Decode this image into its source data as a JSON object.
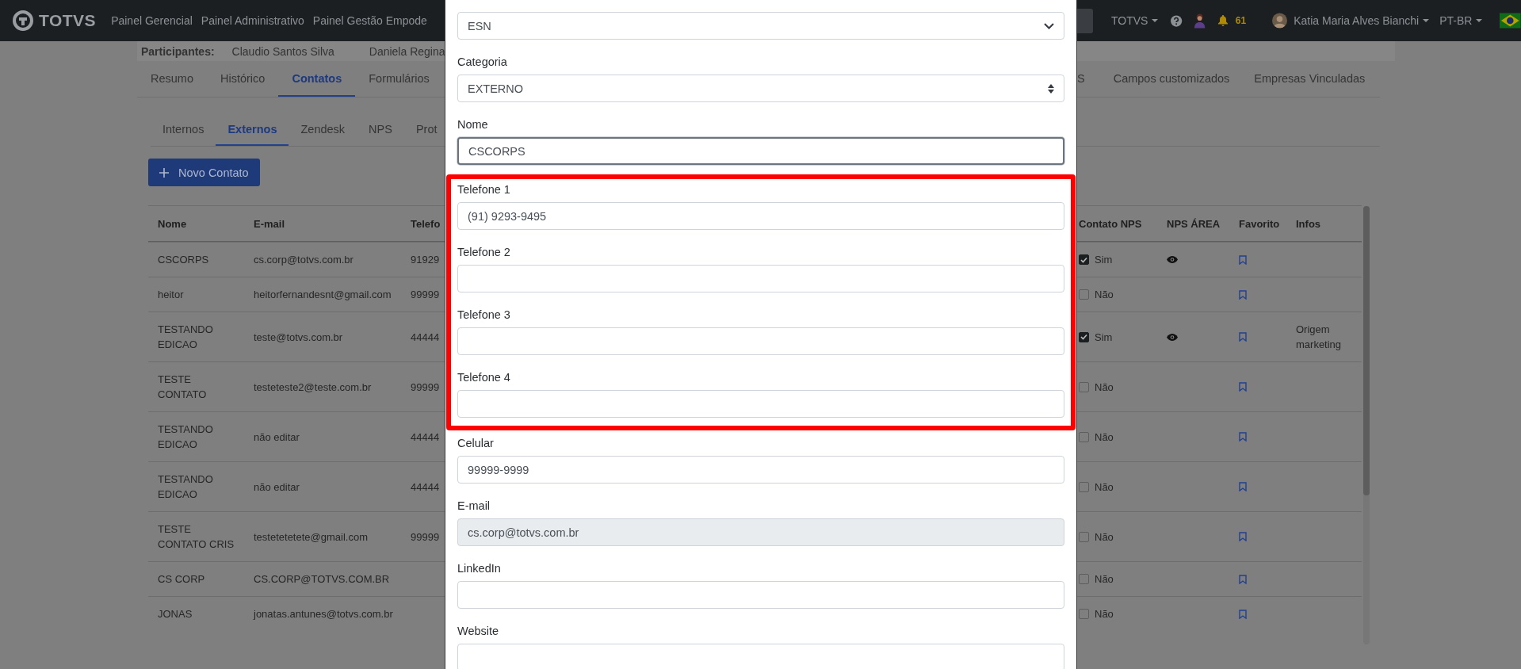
{
  "navbar": {
    "brand": "TOTVS",
    "links": [
      "Painel Gerencial",
      "Painel Administrativo",
      "Painel Gestão Empode"
    ],
    "org_menu": "TOTVS",
    "notifications": "61",
    "user": "Katia Maria Alves Bianchi",
    "language": "PT-BR"
  },
  "participants": {
    "label": "Participantes:",
    "names": [
      "Claudio Santos Silva",
      "Daniela Regina"
    ]
  },
  "tabs": {
    "before_modal": [
      {
        "label": "Resumo",
        "selected": false
      },
      {
        "label": "Histórico",
        "selected": false
      },
      {
        "label": "Contatos",
        "selected": true
      },
      {
        "label": "Formulários",
        "selected": false
      }
    ],
    "after_modal": [
      {
        "label": "S",
        "selected": false
      },
      {
        "label": "Campos customizados",
        "selected": false
      },
      {
        "label": "Empresas Vinculadas",
        "selected": false
      }
    ]
  },
  "subtabs": [
    {
      "label": "Internos",
      "selected": false
    },
    {
      "label": "Externos",
      "selected": true
    },
    {
      "label": "Zendesk",
      "selected": false
    },
    {
      "label": "NPS",
      "selected": false
    },
    {
      "label": "Prot",
      "selected": false
    }
  ],
  "new_contact_button": "Novo Contato",
  "table": {
    "columns_before_modal": [
      "Nome",
      "E-mail",
      "Telefo"
    ],
    "columns_after_modal": [
      "Contato NPS",
      "NPS ÁREA",
      "Favorito",
      "Infos"
    ],
    "rows": [
      {
        "name": "CSCORPS",
        "email": "cs.corp@totvs.com.br",
        "phone": "91929",
        "nps_contact": true,
        "nps_label": "Sim",
        "nps_area": true,
        "favorite": false
      },
      {
        "name": "heitor",
        "email": "heitorfernandesnt@gmail.com",
        "phone": "99999",
        "nps_contact": false,
        "nps_label": "Não",
        "nps_area": false,
        "favorite": false
      },
      {
        "name": "TESTANDO EDICAO",
        "email": "teste@totvs.com.br",
        "phone": "44444",
        "nps_contact": true,
        "nps_label": "Sim",
        "nps_area": true,
        "favorite": false,
        "infos": "Origem marketing"
      },
      {
        "name": "TESTE CONTATO",
        "email": "testeteste2@teste.com.br",
        "phone": "99999",
        "nps_contact": false,
        "nps_label": "Não",
        "nps_area": false,
        "favorite": false
      },
      {
        "name": "TESTANDO EDICAO",
        "email": "não editar",
        "phone": "44444",
        "nps_contact": false,
        "nps_label": "Não",
        "nps_area": false,
        "favorite": false
      },
      {
        "name": "TESTANDO EDICAO",
        "email": "não editar",
        "phone": "44444",
        "nps_contact": false,
        "nps_label": "Não",
        "nps_area": false,
        "favorite": false
      },
      {
        "name": "TESTE CONTATO CRIS",
        "email": "testetetetete@gmail.com",
        "phone": "99999",
        "nps_contact": false,
        "nps_label": "Não",
        "nps_area": false,
        "favorite": false
      },
      {
        "name": "CS CORP",
        "email": "CS.CORP@TOTVS.COM.BR",
        "nps_contact": false,
        "nps_label": "Não",
        "nps_area": false,
        "favorite": false
      },
      {
        "name": "JONAS",
        "email": "jonatas.antunes@totvs.com.br",
        "nps_contact": false,
        "nps_label": "Não",
        "nps_area": false,
        "favorite": false
      }
    ]
  },
  "modal": {
    "fields_before": [
      {
        "kind": "select",
        "value": "ESN",
        "focused": false,
        "disabled": false
      },
      {
        "kind": "spinner-select",
        "label": "Categoria",
        "value": "EXTERNO",
        "focused": false,
        "disabled": false
      },
      {
        "kind": "input",
        "label": "Nome",
        "value": "CSCORPS",
        "focused": true,
        "disabled": false
      }
    ],
    "highlighted_fields": [
      {
        "kind": "input",
        "label": "Telefone 1",
        "value": "(91) 9293-9495",
        "focused": false,
        "disabled": false
      },
      {
        "kind": "input",
        "label": "Telefone 2",
        "focused": false,
        "disabled": false
      },
      {
        "kind": "input",
        "label": "Telefone 3",
        "focused": false,
        "disabled": false
      },
      {
        "kind": "input",
        "label": "Telefone 4",
        "focused": false,
        "disabled": false
      }
    ],
    "fields_after": [
      {
        "kind": "input",
        "label": "Celular",
        "value": "99999-9999",
        "focused": false,
        "disabled": false
      },
      {
        "kind": "input",
        "label": "E-mail",
        "value": "cs.corp@totvs.com.br",
        "focused": false,
        "disabled": true
      },
      {
        "kind": "input",
        "label": "LinkedIn",
        "focused": false,
        "disabled": false
      },
      {
        "kind": "input",
        "label": "Website",
        "focused": false,
        "disabled": false
      }
    ]
  }
}
